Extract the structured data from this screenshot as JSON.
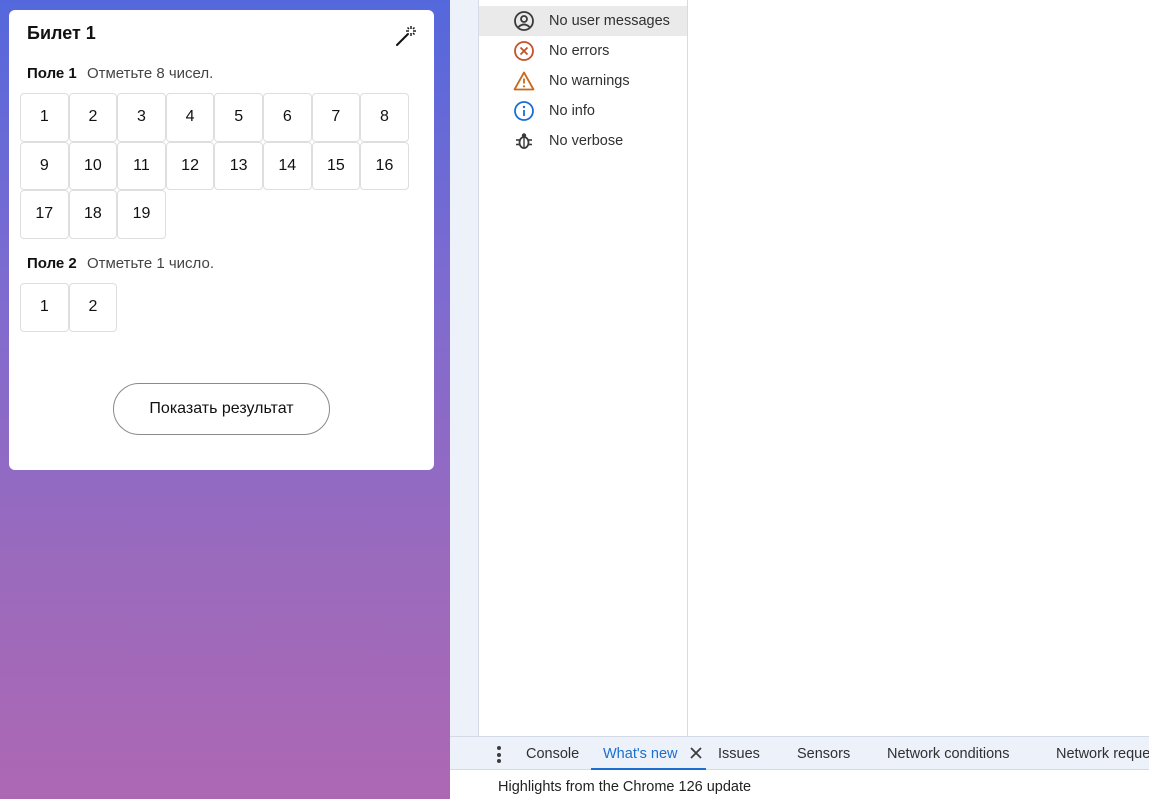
{
  "ticket": {
    "title": "Билет 1",
    "field1": {
      "label": "Поле 1",
      "hint": "Отметьте 8 чисел.",
      "numbers": [
        "1",
        "2",
        "3",
        "4",
        "5",
        "6",
        "7",
        "8",
        "9",
        "10",
        "11",
        "12",
        "13",
        "14",
        "15",
        "16",
        "17",
        "18",
        "19"
      ]
    },
    "field2": {
      "label": "Поле 2",
      "hint": "Отметьте 1 число.",
      "numbers": [
        "1",
        "2"
      ]
    },
    "result_button": "Показать результат",
    "wand_icon": "magic-wand-icon"
  },
  "devtools": {
    "filters": [
      {
        "label": "No user messages",
        "icon": "user-circle-icon"
      },
      {
        "label": "No errors",
        "icon": "error-circle-icon"
      },
      {
        "label": "No warnings",
        "icon": "warning-triangle-icon"
      },
      {
        "label": "No info",
        "icon": "info-circle-icon"
      },
      {
        "label": "No verbose",
        "icon": "bug-icon"
      }
    ],
    "tabs": {
      "console": "Console",
      "whats_new": "What's new",
      "issues": "Issues",
      "sensors": "Sensors",
      "network_conditions": "Network conditions",
      "network_request": "Network reque"
    },
    "whats_new_text": "Highlights from the Chrome 126 update",
    "colors": {
      "accent": "#1a6fd1",
      "error": "#c5522a",
      "warning": "#c96a1b",
      "info": "#1a6fd1"
    }
  }
}
